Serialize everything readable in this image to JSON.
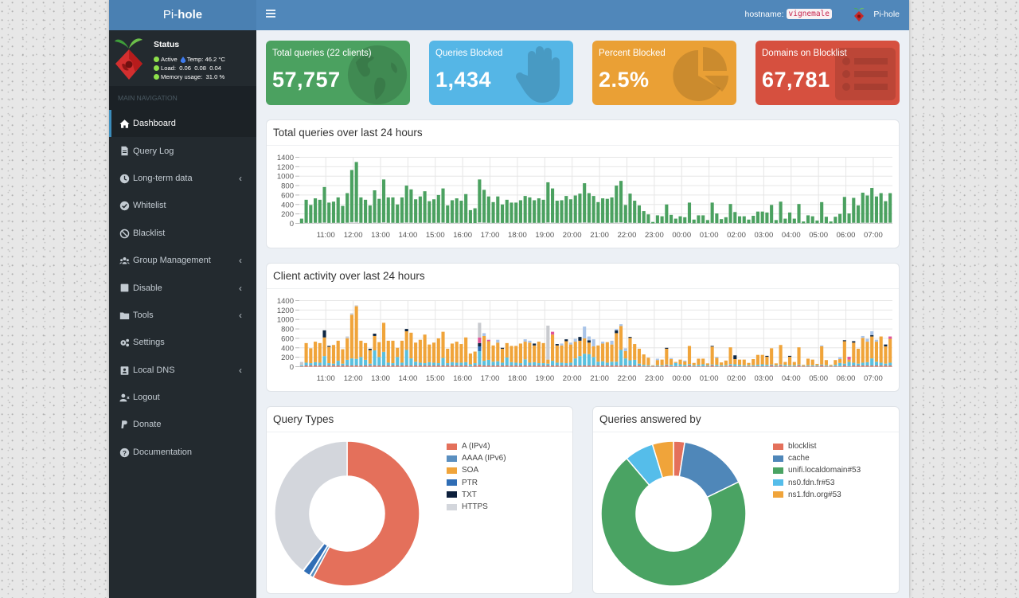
{
  "logo": {
    "prefix": "Pi-",
    "suffix": "hole"
  },
  "navbar": {
    "hostname_label": "hostname:",
    "hostname": "vignemale",
    "user": "Pi-hole"
  },
  "status": {
    "title": "Status",
    "active": "Active",
    "temp": "Temp: 46.2 °C",
    "load": "Load:  0.06  0.08  0.04",
    "memory": "Memory usage:  31.0 %"
  },
  "sidebar": {
    "header": "MAIN NAVIGATION",
    "items": [
      {
        "label": "Dashboard",
        "icon": "home-icon",
        "active": true
      },
      {
        "label": "Query Log",
        "icon": "file-icon"
      },
      {
        "label": "Long-term data",
        "icon": "clock-icon",
        "submenu": true
      },
      {
        "label": "Whitelist",
        "icon": "check-circle-icon"
      },
      {
        "label": "Blacklist",
        "icon": "ban-icon"
      },
      {
        "label": "Group Management",
        "icon": "users-icon",
        "submenu": true
      },
      {
        "label": "Disable",
        "icon": "stop-icon",
        "submenu": true
      },
      {
        "label": "Tools",
        "icon": "folder-icon",
        "submenu": true
      },
      {
        "label": "Settings",
        "icon": "cogs-icon"
      },
      {
        "label": "Local DNS",
        "icon": "address-card-icon",
        "submenu": true
      },
      {
        "label": "Logout",
        "icon": "user-times-icon"
      },
      {
        "label": "Donate",
        "icon": "paypal-icon"
      },
      {
        "label": "Documentation",
        "icon": "question-circle-icon"
      }
    ],
    "chevron": "‹"
  },
  "stats": [
    {
      "label": "Total queries (22 clients)",
      "value": "57,757",
      "color": "#4ba160",
      "icon": "globe-icon"
    },
    {
      "label": "Queries Blocked",
      "value": "1,434",
      "color": "#55b6e6",
      "icon": "hand-icon"
    },
    {
      "label": "Percent Blocked",
      "value": "2.5%",
      "color": "#eaa035",
      "icon": "pie-chart-icon"
    },
    {
      "label": "Domains on Blocklist",
      "value": "67,781",
      "color": "#d6503f",
      "icon": "list-icon"
    }
  ],
  "chart_data": [
    {
      "type": "bar",
      "stacked": true,
      "title": "Total queries over last 24 hours",
      "xlabel": "",
      "ylabel": "",
      "ylim": [
        0,
        1400
      ],
      "yticks": [
        0,
        200,
        400,
        600,
        800,
        1000,
        1200,
        1400
      ],
      "grid": true,
      "x_start": "10:07",
      "interval_minutes": 10,
      "x_ticks": [
        "11:00",
        "12:00",
        "13:00",
        "14:00",
        "15:00",
        "16:00",
        "17:00",
        "18:00",
        "19:00",
        "20:00",
        "21:00",
        "22:00",
        "23:00",
        "00:00",
        "01:00",
        "02:00",
        "03:00",
        "04:00",
        "05:00",
        "06:00",
        "07:00"
      ],
      "total": {
        "color": "#4ba160",
        "values": [
          100,
          500,
          390,
          530,
          500,
          770,
          440,
          460,
          550,
          370,
          640,
          1130,
          1300,
          550,
          500,
          380,
          700,
          520,
          930,
          550,
          550,
          400,
          550,
          800,
          720,
          510,
          570,
          680,
          470,
          510,
          600,
          740,
          380,
          490,
          530,
          480,
          620,
          280,
          320,
          930,
          710,
          570,
          450,
          570,
          400,
          500,
          440,
          440,
          490,
          580,
          550,
          490,
          530,
          500,
          870,
          740,
          480,
          490,
          580,
          510,
          590,
          630,
          850,
          640,
          580,
          450,
          530,
          520,
          550,
          800,
          900,
          390,
          630,
          480,
          380,
          260,
          190,
          30,
          170,
          150,
          400,
          180,
          100,
          150,
          130,
          440,
          80,
          170,
          170,
          70,
          440,
          210,
          90,
          130,
          410,
          240,
          150,
          150,
          80,
          160,
          250,
          250,
          230,
          390,
          70,
          460,
          100,
          230,
          100,
          410,
          40,
          170,
          150,
          60,
          450,
          140,
          40,
          140,
          200,
          560,
          210,
          540,
          380,
          650,
          590,
          750,
          570,
          640,
          470,
          640
        ]
      },
      "blocked": {
        "color": "#cfd1d4",
        "values": [
          3,
          12,
          10,
          13,
          12,
          19,
          11,
          12,
          14,
          9,
          16,
          28,
          32,
          14,
          12,
          10,
          18,
          13,
          23,
          14,
          14,
          10,
          14,
          20,
          18,
          13,
          14,
          17,
          12,
          13,
          15,
          18,
          10,
          12,
          13,
          12,
          15,
          7,
          8,
          23,
          18,
          14,
          11,
          14,
          10,
          12,
          11,
          11,
          12,
          14,
          14,
          12,
          13,
          12,
          22,
          18,
          12,
          12,
          14,
          13,
          15,
          16,
          21,
          16,
          14,
          11,
          13,
          13,
          14,
          20,
          22,
          10,
          16,
          12,
          10,
          6,
          5,
          1,
          4,
          4,
          10,
          4,
          2,
          4,
          3,
          11,
          2,
          4,
          4,
          2,
          11,
          5,
          2,
          3,
          10,
          6,
          4,
          4,
          2,
          4,
          6,
          6,
          6,
          10,
          2,
          12,
          2,
          6,
          2,
          10,
          1,
          4,
          4,
          2,
          11,
          4,
          1,
          4,
          5,
          14,
          5,
          14,
          10,
          16,
          15,
          19,
          14,
          16,
          12,
          16
        ]
      }
    },
    {
      "type": "bar",
      "stacked": true,
      "title": "Client activity over last 24 hours",
      "xlabel": "",
      "ylabel": "",
      "ylim": [
        0,
        1400
      ],
      "yticks": [
        0,
        200,
        400,
        600,
        800,
        1000,
        1200,
        1400
      ],
      "grid": true,
      "x_start": "10:07",
      "interval_minutes": 10,
      "x_ticks": [
        "11:00",
        "12:00",
        "13:00",
        "14:00",
        "15:00",
        "16:00",
        "17:00",
        "18:00",
        "19:00",
        "20:00",
        "21:00",
        "22:00",
        "23:00",
        "00:00",
        "01:00",
        "02:00",
        "03:00",
        "04:00",
        "05:00",
        "06:00",
        "07:00"
      ],
      "series": [
        {
          "color": "#e4705b",
          "values": [
            10,
            25,
            25,
            25,
            25,
            25,
            25,
            25,
            25,
            25,
            25,
            25,
            25,
            25,
            25,
            25,
            25,
            25,
            25,
            25,
            25,
            25,
            25,
            25,
            25,
            25,
            25,
            25,
            25,
            25,
            25,
            25,
            25,
            25,
            25,
            25,
            25,
            10,
            25,
            40,
            25,
            25,
            25,
            25,
            25,
            25,
            25,
            25,
            25,
            25,
            25,
            25,
            25,
            25,
            25,
            25,
            25,
            25,
            25,
            25,
            25,
            25,
            25,
            25,
            25,
            25,
            25,
            25,
            25,
            25,
            25,
            25,
            25,
            25,
            25,
            10,
            10,
            10,
            10,
            10,
            25,
            10,
            10,
            10,
            10,
            25,
            10,
            10,
            10,
            10,
            25,
            10,
            10,
            10,
            25,
            10,
            10,
            10,
            10,
            10,
            10,
            10,
            10,
            25,
            10,
            25,
            10,
            10,
            10,
            25,
            10,
            10,
            10,
            10,
            25,
            10,
            10,
            10,
            10,
            25,
            10,
            25,
            25,
            25,
            25,
            25,
            25,
            25,
            25,
            25
          ]
        },
        {
          "color": "#5bc0de",
          "values": [
            20,
            60,
            50,
            70,
            60,
            200,
            50,
            40,
            100,
            40,
            120,
            150,
            140,
            180,
            120,
            40,
            320,
            180,
            290,
            60,
            50,
            180,
            60,
            330,
            150,
            80,
            60,
            50,
            70,
            60,
            50,
            160,
            50,
            70,
            60,
            60,
            70,
            40,
            50,
            290,
            100,
            120,
            80,
            90,
            60,
            170,
            70,
            60,
            50,
            130,
            60,
            70,
            50,
            50,
            40,
            100,
            60,
            60,
            50,
            60,
            150,
            200,
            250,
            240,
            180,
            80,
            90,
            60,
            80,
            80,
            330,
            150,
            110,
            120,
            40,
            30,
            20,
            10,
            20,
            20,
            20,
            30,
            70,
            40,
            30,
            30,
            20,
            30,
            40,
            20,
            20,
            30,
            20,
            20,
            30,
            40,
            30,
            20,
            20,
            20,
            30,
            40,
            30,
            20,
            20,
            20,
            30,
            20,
            20,
            20,
            10,
            20,
            20,
            20,
            20,
            20,
            10,
            30,
            70,
            40,
            90,
            60,
            40,
            60,
            70,
            150,
            80,
            60,
            40,
            60
          ]
        },
        {
          "color": "#f0a43a",
          "values": [
            0,
            415,
            315,
            435,
            415,
            395,
            345,
            395,
            425,
            305,
            455,
            925,
            1115,
            345,
            355,
            285,
            305,
            315,
            615,
            465,
            475,
            195,
            465,
            395,
            545,
            405,
            485,
            605,
            375,
            425,
            525,
            555,
            305,
            395,
            445,
            395,
            525,
            230,
            245,
            0,
            525,
            395,
            345,
            395,
            295,
            305,
            345,
            355,
            415,
            375,
            425,
            355,
            455,
            425,
            85,
            555,
            365,
            365,
            465,
            385,
            355,
            325,
            325,
            245,
            225,
            345,
            375,
            435,
            365,
            605,
            505,
            155,
            475,
            335,
            315,
            220,
            160,
            10,
            110,
            120,
            335,
            120,
            20,
            100,
            70,
            385,
            50,
            130,
            120,
            40,
            380,
            150,
            60,
            100,
            355,
            110,
            110,
            120,
            50,
            130,
            210,
            200,
            170,
            345,
            40,
            415,
            60,
            180,
            70,
            365,
            20,
            140,
            120,
            30,
            385,
            110,
            20,
            100,
            80,
            475,
            50,
            425,
            315,
            525,
            435,
            465,
            425,
            555,
            365,
            505
          ]
        },
        {
          "color": "#2f6db5",
          "sparse": [
            [
              39,
              100
            ]
          ]
        },
        {
          "color": "#0f2743",
          "sparse": [
            [
              5,
              150
            ],
            [
              6,
              20
            ],
            [
              15,
              30
            ],
            [
              16,
              50
            ],
            [
              23,
              50
            ],
            [
              39,
              70
            ],
            [
              44,
              20
            ],
            [
              51,
              40
            ],
            [
              56,
              30
            ],
            [
              58,
              40
            ],
            [
              61,
              80
            ],
            [
              63,
              50
            ],
            [
              69,
              60
            ],
            [
              72,
              20
            ],
            [
              80,
              20
            ],
            [
              90,
              15
            ],
            [
              95,
              80
            ],
            [
              102,
              20
            ],
            [
              107,
              20
            ],
            [
              119,
              20
            ],
            [
              121,
              30
            ],
            [
              125,
              30
            ],
            [
              128,
              40
            ]
          ]
        },
        {
          "color": "#a9c4e8",
          "sparse": [
            [
              40,
              60
            ],
            [
              43,
              60
            ],
            [
              49,
              50
            ],
            [
              50,
              40
            ],
            [
              57,
              40
            ],
            [
              59,
              40
            ],
            [
              60,
              60
            ],
            [
              62,
              250
            ],
            [
              63,
              80
            ],
            [
              64,
              150
            ],
            [
              66,
              40
            ],
            [
              68,
              80
            ],
            [
              69,
              30
            ],
            [
              70,
              40
            ],
            [
              71,
              60
            ],
            [
              78,
              30
            ],
            [
              81,
              20
            ],
            [
              84,
              20
            ],
            [
              91,
              20
            ],
            [
              114,
              20
            ],
            [
              118,
              40
            ],
            [
              123,
              40
            ],
            [
              124,
              60
            ],
            [
              125,
              80
            ],
            [
              126,
              40
            ]
          ]
        },
        {
          "color": "#e0569b",
          "sparse": [
            [
              39,
              120
            ],
            [
              41,
              30
            ],
            [
              55,
              60
            ],
            [
              120,
              60
            ],
            [
              129,
              50
            ]
          ]
        },
        {
          "color": "#c9cbcf",
          "sparse": [
            [
              0,
              70
            ],
            [
              10,
              40
            ],
            [
              11,
              30
            ],
            [
              12,
              20
            ],
            [
              39,
              310
            ],
            [
              54,
              720
            ]
          ]
        }
      ]
    },
    {
      "type": "pie",
      "donut": true,
      "title": "Query Types",
      "legend": "right",
      "unit": "percent",
      "labels": [
        "A (IPv4)",
        "AAAA (IPv6)",
        "SOA",
        "PTR",
        "TXT",
        "HTTPS"
      ],
      "values": [
        57.8,
        0.8,
        0.1,
        1.7,
        0.1,
        39.5
      ],
      "colors": [
        "#e4705b",
        "#5a8fc0",
        "#f0a43a",
        "#2f6db5",
        "#0d1f3c",
        "#d3d6dc"
      ]
    },
    {
      "type": "pie",
      "donut": true,
      "title": "Queries answered by",
      "legend": "right",
      "unit": "percent",
      "labels": [
        "blocklist",
        "cache",
        "unifi.localdomain#53",
        "ns0.fdn.fr#53",
        "ns1.fdn.org#53"
      ],
      "values": [
        2.5,
        15.3,
        71.0,
        6.5,
        4.7
      ],
      "colors": [
        "#e4705b",
        "#4f87b9",
        "#4aa363",
        "#55bdea",
        "#f0a43a"
      ]
    }
  ]
}
